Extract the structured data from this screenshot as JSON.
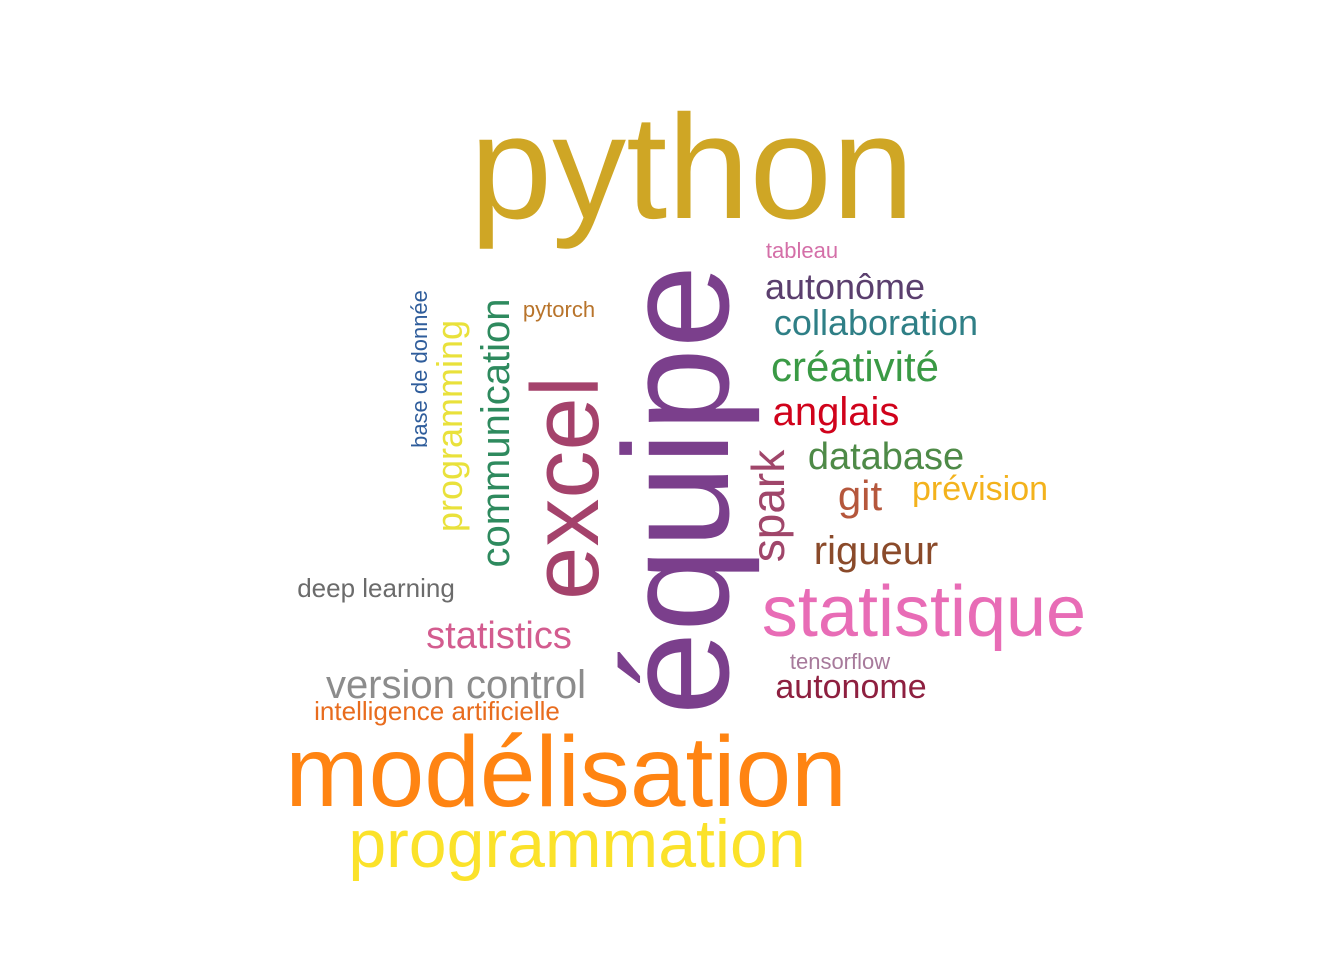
{
  "words": {
    "python": {
      "text": "python",
      "color": "#CFA625"
    },
    "equipe": {
      "text": "équipe",
      "color": "#7B3F8C"
    },
    "excel": {
      "text": "excel",
      "color": "#A4426B"
    },
    "communication": {
      "text": "communication",
      "color": "#2E8A5E"
    },
    "programming": {
      "text": "programming",
      "color": "#E9E13B"
    },
    "base_de_donnee": {
      "text": "base de donnée",
      "color": "#2F5D9B"
    },
    "pytorch": {
      "text": "pytorch",
      "color": "#B8742B"
    },
    "spark": {
      "text": "spark",
      "color": "#A0466A"
    },
    "tableau": {
      "text": "tableau",
      "color": "#D46FA8"
    },
    "autonome_c": {
      "text": "autonôme",
      "color": "#5B3F6E"
    },
    "collaboration": {
      "text": "collaboration",
      "color": "#2F7F86"
    },
    "creativite": {
      "text": "créativité",
      "color": "#3A9A45"
    },
    "anglais": {
      "text": "anglais",
      "color": "#D0021B"
    },
    "database": {
      "text": "database",
      "color": "#4E8A47"
    },
    "git": {
      "text": "git",
      "color": "#B5573C"
    },
    "prevision": {
      "text": "prévision",
      "color": "#F3B21C"
    },
    "rigueur": {
      "text": "rigueur",
      "color": "#8A4A2A"
    },
    "statistique": {
      "text": "statistique",
      "color": "#E86CB6"
    },
    "tensorflow": {
      "text": "tensorflow",
      "color": "#A77A9B"
    },
    "autonome": {
      "text": "autonome",
      "color": "#8E2040"
    },
    "deep_learning": {
      "text": "deep learning",
      "color": "#6B6B6B"
    },
    "statistics": {
      "text": "statistics",
      "color": "#D35C8F"
    },
    "version_control": {
      "text": "version control",
      "color": "#8C8C8C"
    },
    "ia": {
      "text": "intelligence artificielle",
      "color": "#E86C1E"
    },
    "modelisation": {
      "text": "modélisation",
      "color": "#FF8412"
    },
    "programmation": {
      "text": "programmation",
      "color": "#FBE22A"
    }
  }
}
